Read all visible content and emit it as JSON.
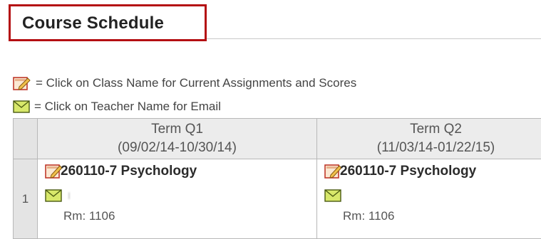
{
  "page": {
    "title": "Course Schedule"
  },
  "legend": {
    "class_hint": "= Click on Class Name for Current Assignments and Scores",
    "teacher_hint": "= Click on Teacher Name for Email"
  },
  "icons": {
    "class_icon": "edit-note-icon",
    "teacher_icon": "envelope-icon"
  },
  "colors": {
    "title_border": "#b40f12",
    "header_bg": "#ececec",
    "envelope": "#d8e86a"
  },
  "table": {
    "columns": [
      {
        "term": "Term Q1",
        "dates": "(09/02/14-10/30/14)"
      },
      {
        "term": "Term Q2",
        "dates": "(11/03/14-01/22/15)"
      }
    ],
    "rows": [
      {
        "index": "1",
        "cells": [
          {
            "class_name": "260110-7 Psychology",
            "teacher": "I",
            "room": "Rm: 1106"
          },
          {
            "class_name": "260110-7 Psychology",
            "teacher": "",
            "room": "Rm: 1106"
          }
        ]
      }
    ]
  }
}
